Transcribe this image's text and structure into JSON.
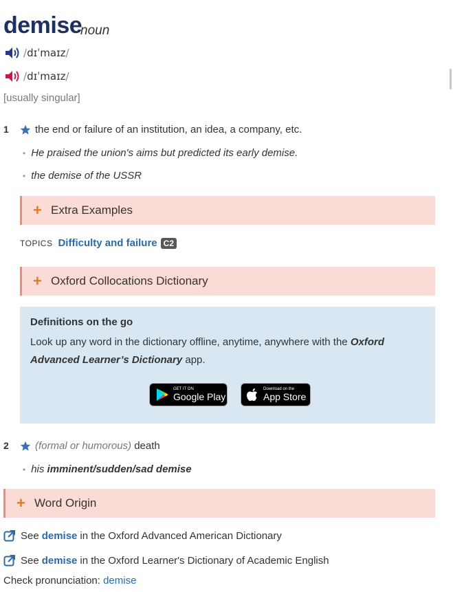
{
  "entry": {
    "headword": "demise",
    "pos": "noun",
    "pron_br": "dɪˈmaɪz",
    "pron_us": "dɪˈmaɪz",
    "grammar": "[usually singular]"
  },
  "senses": [
    {
      "number": "1",
      "definition": "the end or failure of an institution, an idea, a company, etc.",
      "examples": [
        "He praised the union's aims but predicted its early demise.",
        "the demise of the USSR"
      ]
    },
    {
      "number": "2",
      "label": "(formal or humorous)",
      "definition": "death",
      "example_pre": "his ",
      "example_bold": "imminent/sudden/sad demise"
    }
  ],
  "expanders": {
    "extra_examples": "Extra Examples",
    "collocations": "Oxford Collocations Dictionary",
    "word_origin": "Word Origin"
  },
  "topics": {
    "label": "TOPICS",
    "value": "Difficulty and failure",
    "level": "C2"
  },
  "promo": {
    "heading": "Definitions on the go",
    "body_pre": "Look up any word in the dictionary offline, anytime, anywhere with the ",
    "body_title": "Oxford Advanced Learner’s Dictionary",
    "body_post": " app.",
    "google_small": "GET IT ON",
    "google_big": "Google Play",
    "apple_small": "Download on the",
    "apple_big": "App Store"
  },
  "xrefs": [
    {
      "pre": "See",
      "link": "demise",
      "post": "in the Oxford Advanced American Dictionary"
    },
    {
      "pre": "See",
      "link": "demise",
      "post": "in the Oxford Learner's Dictionary of Academic English"
    }
  ],
  "check_pron": {
    "label": "Check pronunciation:",
    "link": "demise"
  },
  "colors": {
    "headword": "#1f3060",
    "link": "#2a6ba8",
    "expander_bg": "#fbdbd5",
    "expander_border": "#f08a78",
    "plus": "#e77a1c",
    "promo_bg": "#d8e7f2",
    "br_speaker": "#1f3d8c",
    "us_speaker": "#c8194a",
    "star": "#3b6fb6"
  },
  "icons": {
    "br_audio": "speaker-icon",
    "us_audio": "speaker-icon",
    "oxford3000": "star-icon",
    "xref": "external-link-icon"
  }
}
